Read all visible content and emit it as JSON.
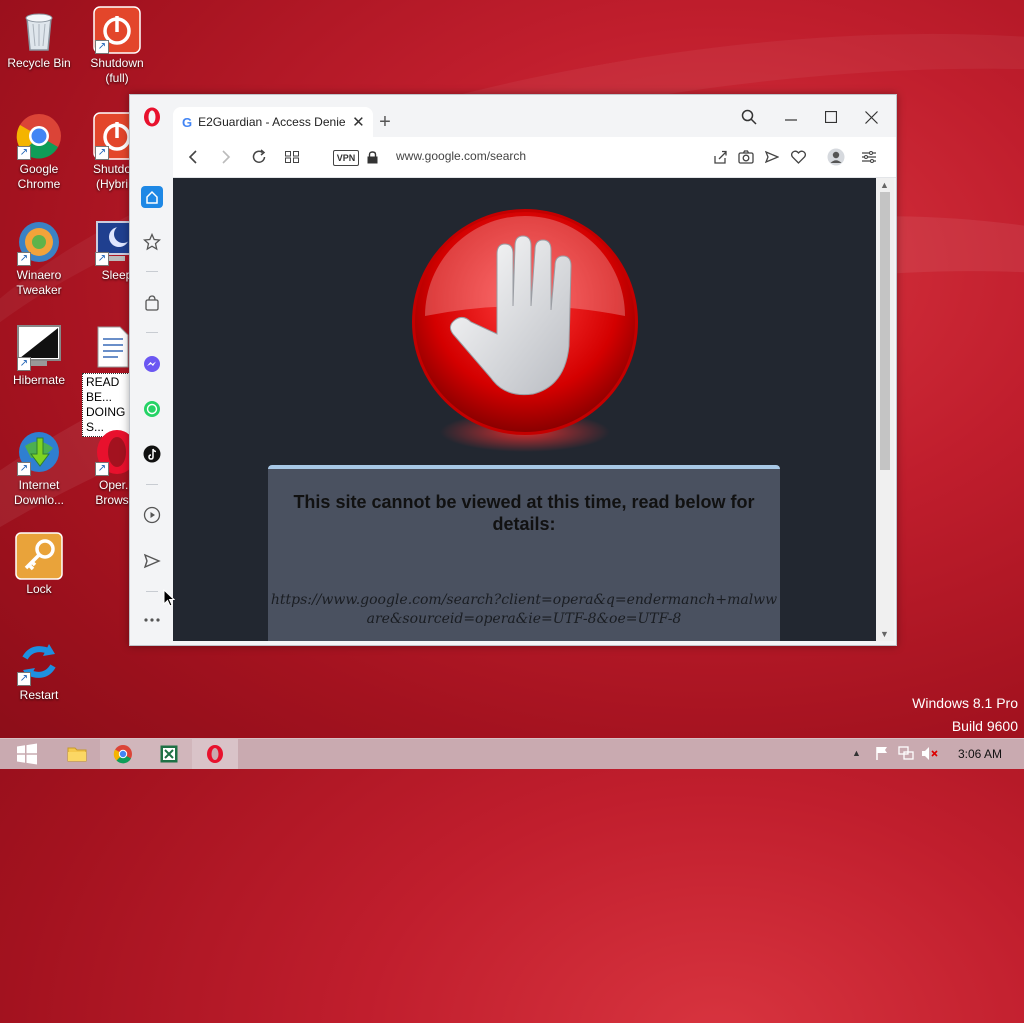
{
  "desktop": {
    "icons": [
      {
        "label": "Recycle Bin"
      },
      {
        "label": "Shutdown (full)"
      },
      {
        "label": "Google Chrome"
      },
      {
        "label": "Shutdo... (Hybri..."
      },
      {
        "label": "Winaero Tweaker"
      },
      {
        "label": "Sleep"
      },
      {
        "label": "Hibernate"
      },
      {
        "label": "READ BE... DOING S..."
      },
      {
        "label": "Internet Downlo..."
      },
      {
        "label": "Oper... Brows..."
      },
      {
        "label": "Lock"
      },
      {
        "label": "Restart"
      }
    ],
    "watermark": {
      "line1": "Windows 8.1 Pro",
      "line2": "Build 9600"
    }
  },
  "browser": {
    "tab_title": "E2Guardian - Access Denie",
    "address": "www.google.com/search",
    "vpn_label": "VPN",
    "sidebar_icons": [
      "home-icon",
      "star-icon",
      "bag-icon",
      "messenger-icon",
      "whatsapp-icon",
      "tiktok-icon",
      "play-icon",
      "send-icon",
      "more-icon"
    ]
  },
  "page": {
    "heading": "This site cannot be viewed at this time, read below for details:",
    "blocked_url_line1": "https://www.google.com/search?client=opera&q=endermanch+malww",
    "blocked_url_line2": "are&sourceid=opera&ie=UTF-8&oe=UTF-8"
  },
  "taskbar": {
    "clock": "3:06 AM",
    "items": [
      "start-icon",
      "file-explorer-icon",
      "chrome-icon",
      "excel-icon",
      "opera-icon"
    ]
  },
  "colors": {
    "accent": "#1e88e5",
    "opera_red": "#e8112d",
    "desktop_red": "#c01e2d"
  }
}
